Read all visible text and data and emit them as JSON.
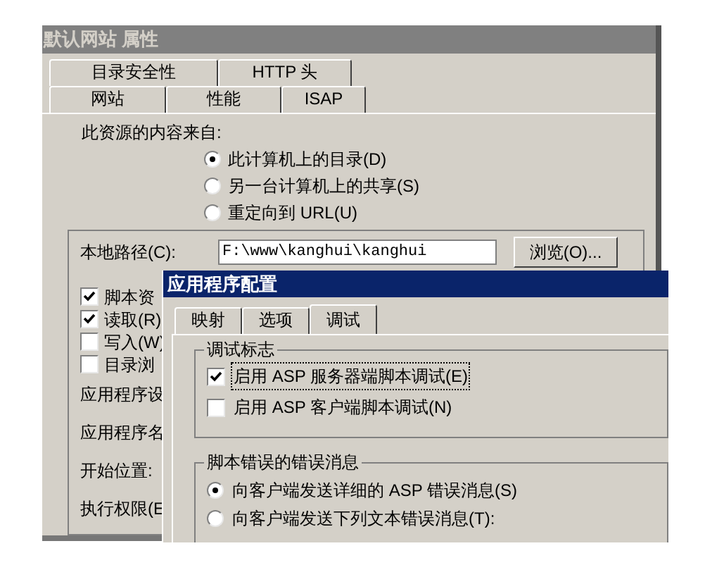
{
  "main_window": {
    "title": "默认网站 属性",
    "tabs_back": [
      {
        "label": "目录安全性",
        "selected": false
      },
      {
        "label": "HTTP 头",
        "selected": false
      }
    ],
    "tabs_front": [
      {
        "label": "网站",
        "selected": false
      },
      {
        "label": "性能",
        "selected": false
      },
      {
        "label": "ISAP",
        "selected": false
      }
    ],
    "content_source": {
      "label": "此资源的内容来自:",
      "options": [
        {
          "label": "此计算机上的目录(D)",
          "selected": true
        },
        {
          "label": "另一台计算机上的共享(S)",
          "selected": false
        },
        {
          "label": "重定向到 URL(U)",
          "selected": false
        }
      ]
    },
    "local_path": {
      "label": "本地路径(C):",
      "value": "F:\\www\\kanghui\\kanghui",
      "browse_button": "浏览(O)..."
    },
    "permissions": [
      {
        "label": "脚本资",
        "checked": true
      },
      {
        "label": "读取(R)",
        "checked": true
      },
      {
        "label": "写入(W)",
        "checked": false
      },
      {
        "label": "目录浏",
        "checked": false
      }
    ],
    "settings_labels": [
      "应用程序设",
      "应用程序名",
      "开始位置:",
      "执行权限(E"
    ]
  },
  "app_config_dialog": {
    "title": "应用程序配置",
    "tabs": [
      {
        "label": "映射",
        "selected": false
      },
      {
        "label": "选项",
        "selected": false
      },
      {
        "label": "调试",
        "selected": true
      }
    ],
    "debug_flags": {
      "title": "调试标志",
      "options": [
        {
          "label": "启用 ASP 服务器端脚本调试(E)",
          "checked": true,
          "focused": true
        },
        {
          "label": "启用 ASP 客户端脚本调试(N)",
          "checked": false,
          "focused": false
        }
      ]
    },
    "error_messages": {
      "title": "脚本错误的错误消息",
      "options": [
        {
          "label": "向客户端发送详细的 ASP 错误消息(S)",
          "selected": true
        },
        {
          "label": "向客户端发送下列文本错误消息(T):",
          "selected": false
        }
      ]
    }
  }
}
